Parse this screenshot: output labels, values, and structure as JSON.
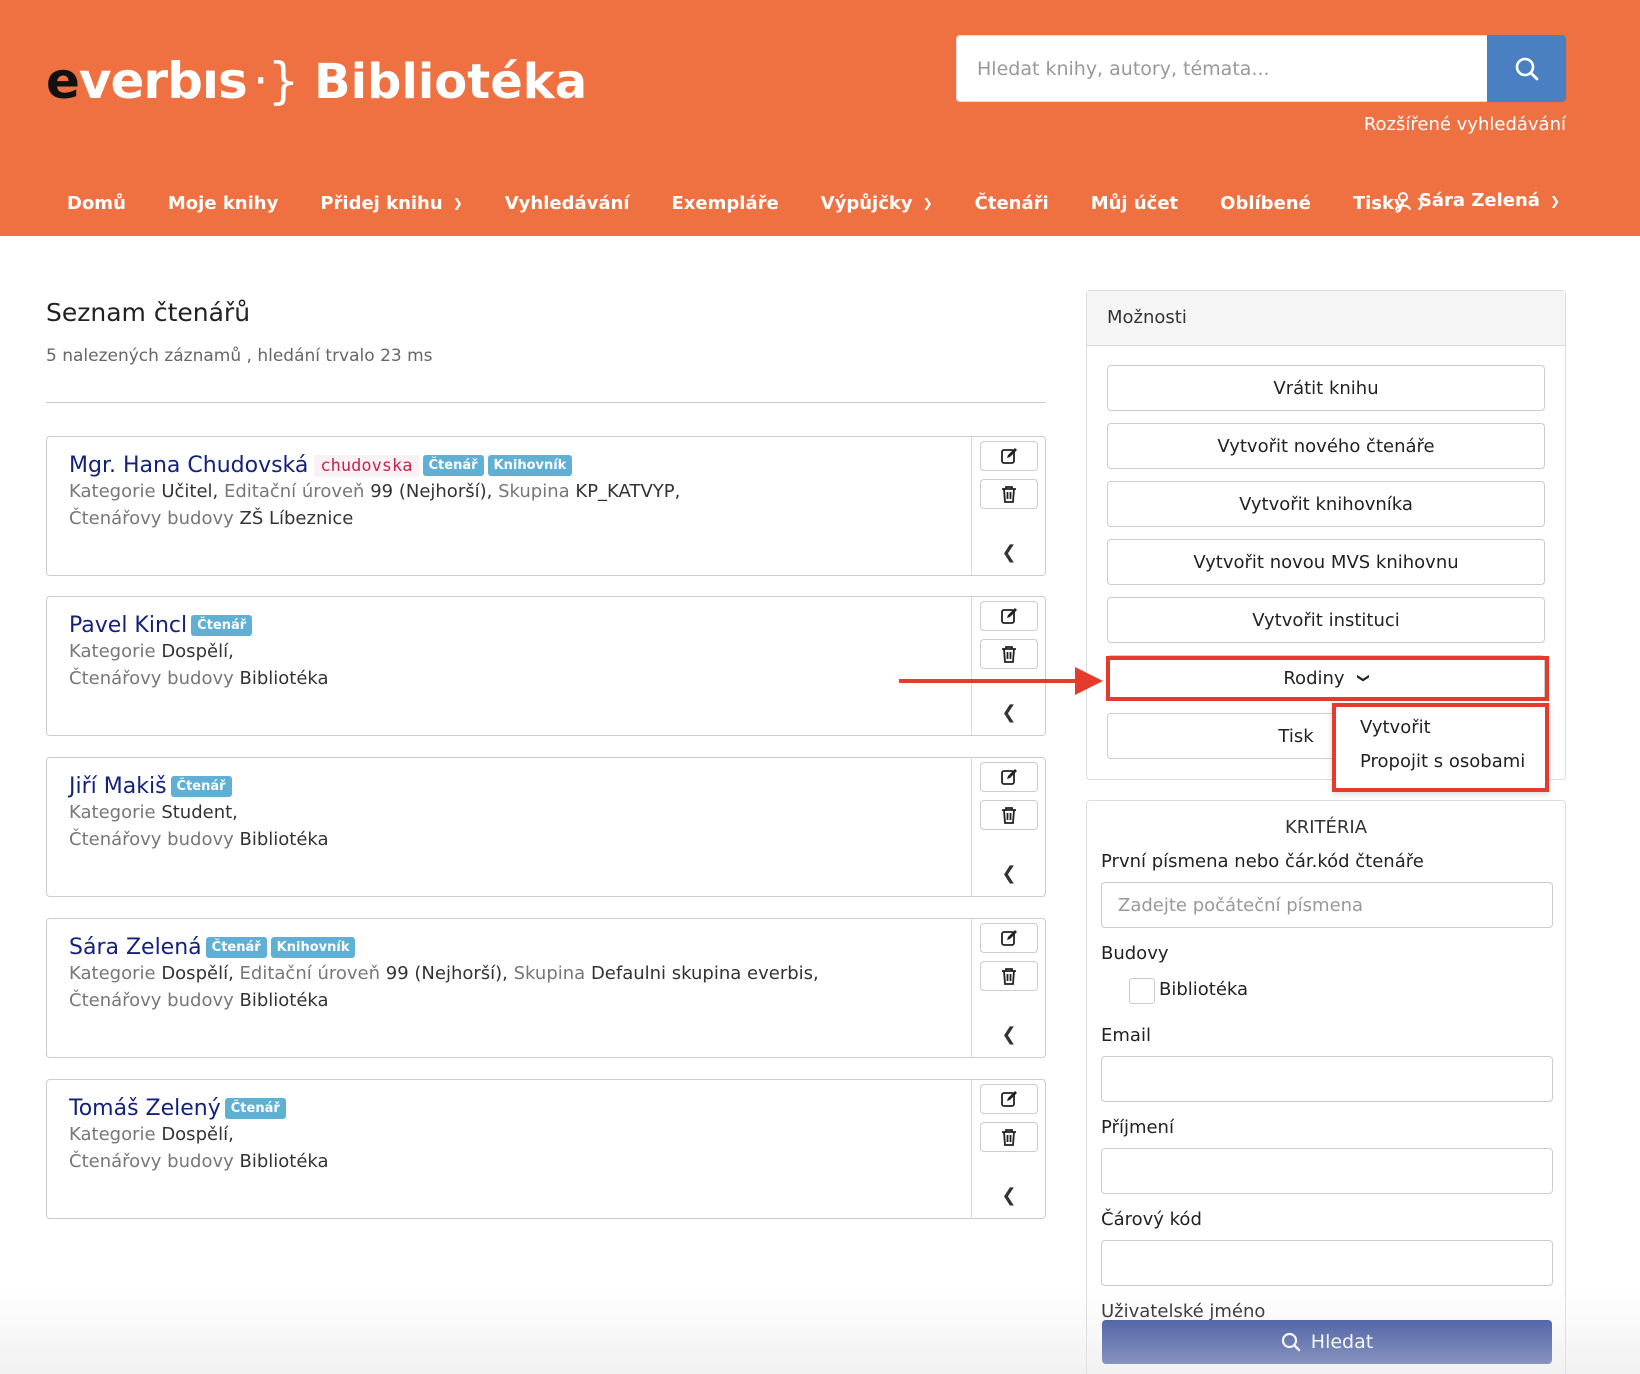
{
  "header": {
    "logo_prefix": "e",
    "logo_rest": "verbıs",
    "logo_brace": "·}",
    "app_title": "Bibliotéka",
    "search_placeholder": "Hledat knihy, autory, témata...",
    "advanced_search": "Rozšířené vyhledávání",
    "accent_color": "#ef7142"
  },
  "nav": {
    "items": [
      {
        "label": "Domů"
      },
      {
        "label": "Moje knihy"
      },
      {
        "label": "Přidej knihu"
      },
      {
        "label": "Vyhledávání"
      },
      {
        "label": "Exempláře"
      },
      {
        "label": "Výpůjčky"
      },
      {
        "label": "Čtenáři"
      },
      {
        "label": "Můj účet"
      },
      {
        "label": "Oblíbené"
      },
      {
        "label": "Tisky"
      }
    ],
    "user": "Sára Zelená"
  },
  "main": {
    "title": "Seznam čtenářů",
    "result_info": "5 nalezených záznamů , hledání trvalo 23 ms",
    "labels": {
      "kategorie": "Kategorie",
      "editacni": "Editační úroveň",
      "skupina": "Skupina",
      "budovy": "Čtenářovy budovy"
    },
    "readers": [
      {
        "name": "Mgr. Hana Chudovská",
        "login": "chudovska",
        "badge1": "Čtenář",
        "badge2": "Knihovník",
        "kategorie": "Učitel,",
        "editacni": "99 (Nejhorší),",
        "skupina": "KP_KATVYP,",
        "budovy": "ZŠ Líbeznice"
      },
      {
        "name": "Pavel Kincl",
        "badge1": "Čtenář",
        "kategorie": "Dospělí,",
        "budovy": "Bibliotéka"
      },
      {
        "name": "Jiří Makiš",
        "badge1": "Čtenář",
        "kategorie": "Student,",
        "budovy": "Bibliotéka"
      },
      {
        "name": "Sára Zelená",
        "badge1": "Čtenář",
        "badge2": "Knihovník",
        "kategorie": "Dospělí,",
        "editacni": "99 (Nejhorší),",
        "skupina": "Defaulni skupina everbis,",
        "budovy": "Bibliotéka"
      },
      {
        "name": "Tomáš Zelený",
        "badge1": "Čtenář",
        "kategorie": "Dospělí,",
        "budovy": "Bibliotéka"
      }
    ]
  },
  "sidebar": {
    "options_title": "Možnosti",
    "buttons": [
      {
        "label": "Vrátit knihu"
      },
      {
        "label": "Vytvořit nového čtenáře"
      },
      {
        "label": "Vytvořit knihovníka"
      },
      {
        "label": "Vytvořit novou MVS knihovnu"
      },
      {
        "label": "Vytvořit instituci"
      },
      {
        "label": "Rodiny"
      },
      {
        "label": "Tisk"
      }
    ],
    "rodiny_menu": [
      {
        "label": "Vytvořit"
      },
      {
        "label": "Propojit s osobami"
      }
    ],
    "criteria": {
      "title": "KRITÉRIA",
      "first_letters_label": "První písmena nebo čár.kód čtenáře",
      "first_letters_placeholder": "Zadejte počáteční písmena",
      "budovy_label": "Budovy",
      "budova_option": "Bibliotéka",
      "email_label": "Email",
      "prijmeni_label": "Příjmení",
      "carovy_label": "Čárový kód",
      "uzivatel_label": "Uživatelské jméno",
      "search_button": "Hledat"
    }
  }
}
